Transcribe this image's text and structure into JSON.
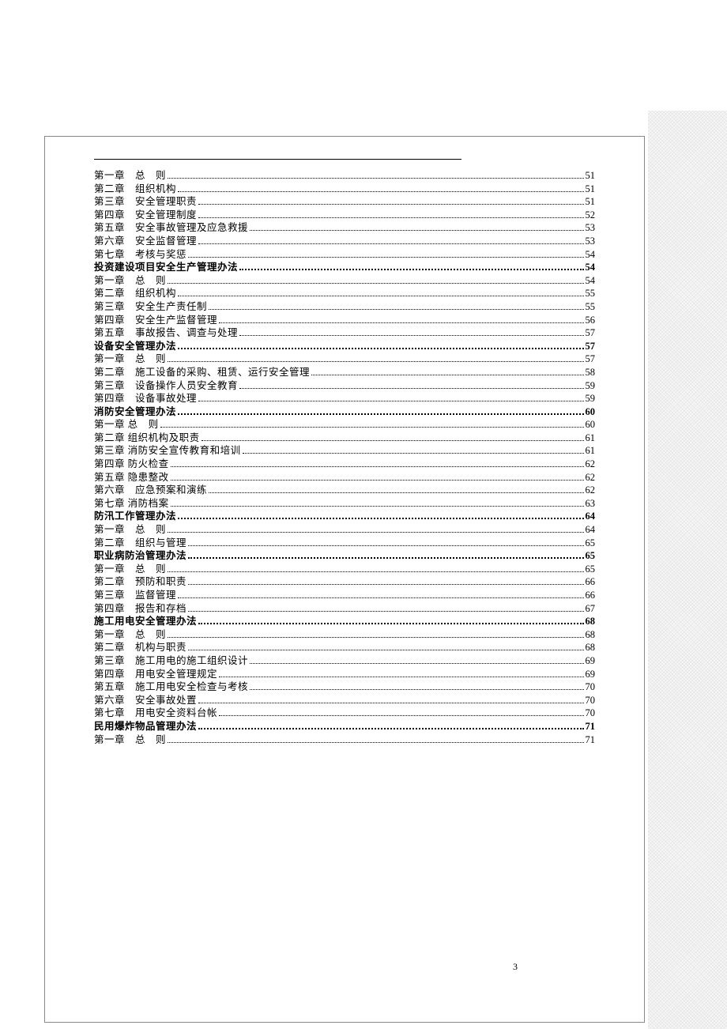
{
  "page_number": "3",
  "toc": [
    {
      "label": "第一章　总　则",
      "page": "51",
      "bold": false
    },
    {
      "label": "第二章　组织机构",
      "page": "51",
      "bold": false
    },
    {
      "label": "第三章　安全管理职责",
      "page": "51",
      "bold": false
    },
    {
      "label": "第四章　安全管理制度",
      "page": "52",
      "bold": false
    },
    {
      "label": "第五章　安全事故管理及应急救援",
      "page": "53",
      "bold": false
    },
    {
      "label": "第六章　安全监督管理",
      "page": "53",
      "bold": false
    },
    {
      "label": "第七章　考核与奖惩",
      "page": "54",
      "bold": false
    },
    {
      "label": "投资建设项目安全生产管理办法",
      "page": "54",
      "bold": true
    },
    {
      "label": "第一章　总　则",
      "page": "54",
      "bold": false
    },
    {
      "label": "第二章　组织机构",
      "page": "55",
      "bold": false
    },
    {
      "label": "第三章　安全生产责任制",
      "page": "55",
      "bold": false
    },
    {
      "label": "第四章　安全生产监督管理",
      "page": "56",
      "bold": false
    },
    {
      "label": "第五章　事故报告、调查与处理",
      "page": "57",
      "bold": false
    },
    {
      "label": "设备安全管理办法",
      "page": "57",
      "bold": true
    },
    {
      "label": "第一章　总　则",
      "page": "57",
      "bold": false
    },
    {
      "label": "第二章　施工设备的采购、租赁、运行安全管理",
      "page": "58",
      "bold": false
    },
    {
      "label": "第三章　设备操作人员安全教育",
      "page": "59",
      "bold": false
    },
    {
      "label": "第四章　设备事故处理",
      "page": "59",
      "bold": false
    },
    {
      "label": "消防安全管理办法",
      "page": "60",
      "bold": true
    },
    {
      "label": "第一章 总　则",
      "page": "60",
      "bold": false
    },
    {
      "label": "第二章 组织机构及职责",
      "page": "61",
      "bold": false
    },
    {
      "label": "第三章 消防安全宣传教育和培训",
      "page": "61",
      "bold": false
    },
    {
      "label": "第四章 防火检查",
      "page": "62",
      "bold": false
    },
    {
      "label": "第五章 隐患整改",
      "page": "62",
      "bold": false
    },
    {
      "label": "第六章　应急预案和演练",
      "page": "62",
      "bold": false
    },
    {
      "label": "第七章 消防档案",
      "page": "63",
      "bold": false
    },
    {
      "label": "防汛工作管理办法",
      "page": "64",
      "bold": true
    },
    {
      "label": "第一章　总　则",
      "page": "64",
      "bold": false
    },
    {
      "label": "第二章　组织与管理",
      "page": "65",
      "bold": false
    },
    {
      "label": "职业病防治管理办法",
      "page": "65",
      "bold": true
    },
    {
      "label": "第一章　总　则",
      "page": "65",
      "bold": false
    },
    {
      "label": "第二章　预防和职责",
      "page": "66",
      "bold": false
    },
    {
      "label": "第三章　监督管理",
      "page": "66",
      "bold": false
    },
    {
      "label": "第四章　报告和存档",
      "page": "67",
      "bold": false
    },
    {
      "label": "施工用电安全管理办法",
      "page": "68",
      "bold": true
    },
    {
      "label": "第一章　总　则",
      "page": "68",
      "bold": false
    },
    {
      "label": "第二章　机构与职责",
      "page": "68",
      "bold": false
    },
    {
      "label": "第三章　施工用电的施工组织设计",
      "page": "69",
      "bold": false
    },
    {
      "label": "第四章　用电安全管理规定",
      "page": "69",
      "bold": false
    },
    {
      "label": "第五章　施工用电安全检查与考核",
      "page": "70",
      "bold": false
    },
    {
      "label": "第六章　安全事故处置",
      "page": "70",
      "bold": false
    },
    {
      "label": "第七章　用电安全资料台帐",
      "page": "70",
      "bold": false
    },
    {
      "label": "民用爆炸物品管理办法",
      "page": "71",
      "bold": true
    },
    {
      "label": "第一章　总　则",
      "page": "71",
      "bold": false
    }
  ]
}
